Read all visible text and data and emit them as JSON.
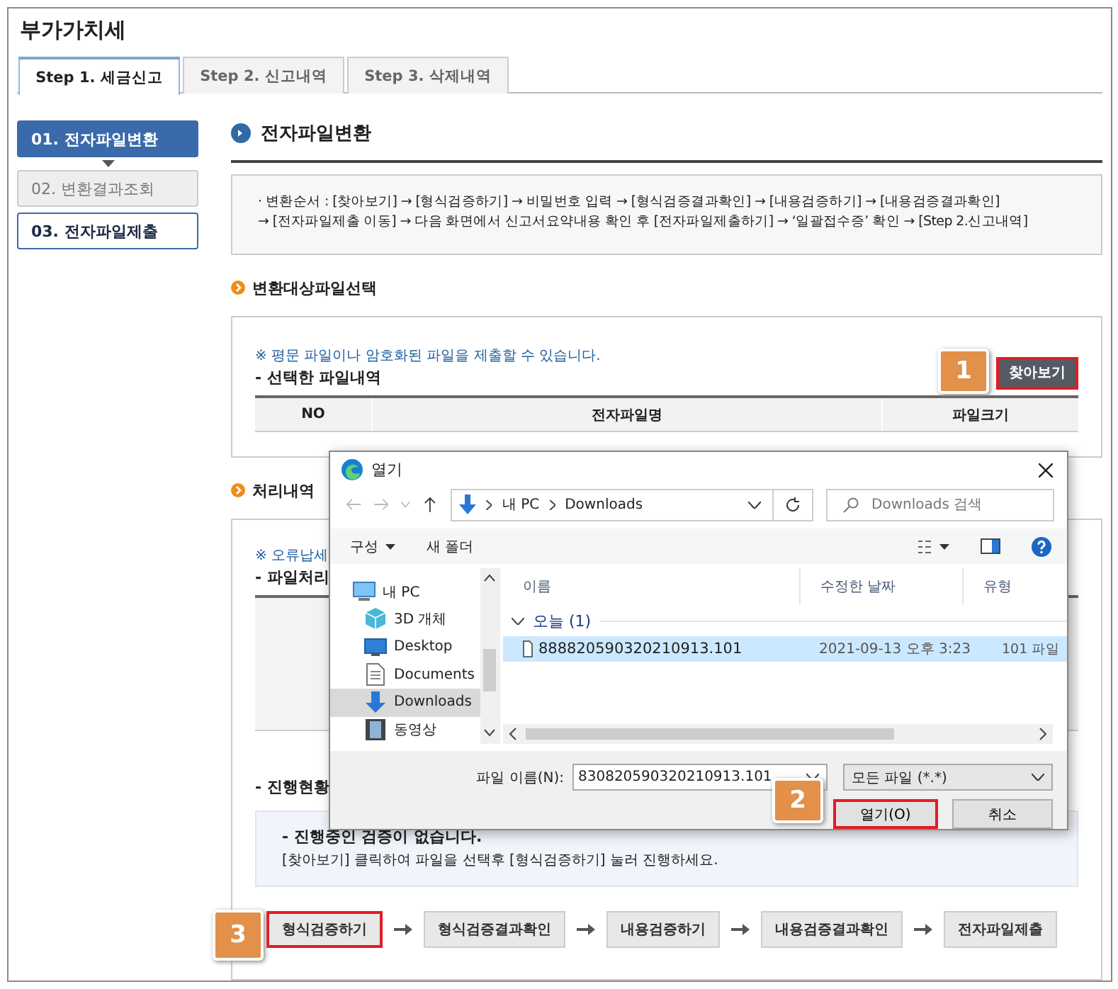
{
  "page_title": "부가가치세",
  "tabs": [
    {
      "label": "Step 1. 세금신고",
      "selected": true
    },
    {
      "label": "Step 2. 신고내역",
      "selected": false
    },
    {
      "label": "Step 3. 삭제내역",
      "selected": false
    }
  ],
  "sidebar": {
    "items": [
      {
        "label": "01. 전자파일변환",
        "selected": true,
        "disabled": false
      },
      {
        "label": "02. 변환결과조회",
        "selected": false,
        "disabled": true
      },
      {
        "label": "03. 전자파일제출",
        "selected": false,
        "disabled": false
      }
    ]
  },
  "section_title": "전자파일변환",
  "instructions": [
    "· 변환순서 : [찾아보기] → [형식검증하기] → 비밀번호 입력 → [형식검증결과확인] → [내용검증하기] → [내용검증결과확인]",
    "→ [전자파일제출 이동] → 다음 화면에서 신고서요약내용 확인 후 [전자파일제출하기]  → ‘일괄접수증’ 확인  → [Step 2.신고내역]"
  ],
  "file_select": {
    "heading": "변환대상파일선택",
    "note": "※ 평문 파일이나 암호화된 파일을 제출할 수 있습니다.",
    "label": "- 선택한 파일내역",
    "callout": "1",
    "browse_button": {
      "label": "찾아보기",
      "highlighted": true
    },
    "columns": [
      "NO",
      "전자파일명",
      "파일크기"
    ]
  },
  "processing": {
    "heading": "처리내역",
    "note": "※ 오류납세",
    "label": "- 파일처리"
  },
  "progress": {
    "label": "- 진행현황",
    "message": "- 진행중인 검증이 없습니다.",
    "hint": "[찾아보기] 클릭하여 파일을 선택후 [형식검증하기] 눌러 진행하세요.",
    "callout": "3",
    "steps": [
      {
        "label": "형식검증하기",
        "highlighted": true
      },
      {
        "label": "형식검증결과확인",
        "highlighted": false
      },
      {
        "label": "내용검증하기",
        "highlighted": false
      },
      {
        "label": "내용검증결과확인",
        "highlighted": false
      },
      {
        "label": "전자파일제출",
        "highlighted": false
      }
    ]
  },
  "dialog": {
    "title": "열기",
    "path": [
      "내 PC",
      "Downloads"
    ],
    "search_placeholder": "Downloads 검색",
    "toolbar": [
      "구성",
      "새 폴더"
    ],
    "nav_items": [
      {
        "label": "내 PC",
        "kind": "pc",
        "selected": false
      },
      {
        "label": "3D 개체",
        "kind": "cube",
        "selected": false
      },
      {
        "label": "Desktop",
        "kind": "desktop",
        "selected": false
      },
      {
        "label": "Documents",
        "kind": "document",
        "selected": false
      },
      {
        "label": "Downloads",
        "kind": "download",
        "selected": true
      },
      {
        "label": "동영상",
        "kind": "video",
        "selected": false
      }
    ],
    "columns": [
      "이름",
      "수정한 날짜",
      "유형"
    ],
    "group": "오늘 (1)",
    "files": [
      {
        "name": "888820590320210913.101",
        "date": "2021-09-13 오후 3:23",
        "type": "101 파일",
        "selected": true
      }
    ],
    "filename_label": "파일 이름(N):",
    "filename": "830820590320210913.101",
    "filter": "모든 파일 (*.*)",
    "callout": "2",
    "buttons": [
      {
        "label": "열기(O)",
        "highlighted": true
      },
      {
        "label": "취소",
        "highlighted": false
      }
    ]
  }
}
